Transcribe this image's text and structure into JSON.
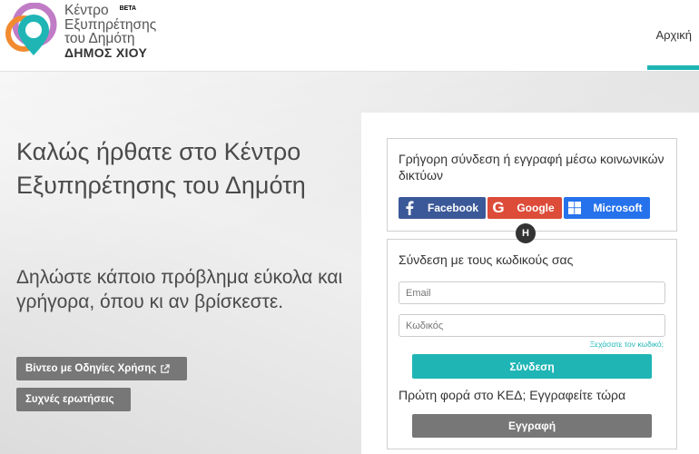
{
  "header": {
    "logo": {
      "line1": "Κέντρο",
      "beta": "BETA",
      "line2": "Εξυπηρέτησης",
      "line3": "του Δημότη",
      "line4": "ΔΗΜΟΣ ΧΙΟΥ"
    },
    "nav_home": "Αρχική"
  },
  "hero": {
    "welcome": "Καλώς ήρθατε στο Κέντρο Εξυπηρέτησης του Δημότη",
    "subtitle": "Δηλώστε κάποιο πρόβλημα εύκολα και γρήγορα, όπου κι αν βρίσκεστε.",
    "video_button": "Βίντεο με Οδηγίες Χρήσης",
    "faq_button": "Συχνές ερωτήσεις"
  },
  "social": {
    "title": "Γρήγορη σύνδεση ή εγγραφή μέσω κοινωνικών δικτύων",
    "facebook": "Facebook",
    "google": "Google",
    "microsoft": "Microsoft"
  },
  "badge": "H",
  "login": {
    "title": "Σύνδεση με τους κωδικούς σας",
    "email_placeholder": "Email",
    "password_placeholder": "Κωδικός",
    "forgot": "Ξεχάσατε τον κωδικό;",
    "login_button": "Σύνδεση",
    "first_time": "Πρώτη φορά στο ΚΕΔ; Εγγραφείτε τώρα",
    "register_button": "Εγγραφή"
  },
  "colors": {
    "accent": "#1fb5b5",
    "facebook": "#3b5998",
    "google": "#dd4b39",
    "microsoft": "#2672ec",
    "dark_button": "#777777"
  }
}
